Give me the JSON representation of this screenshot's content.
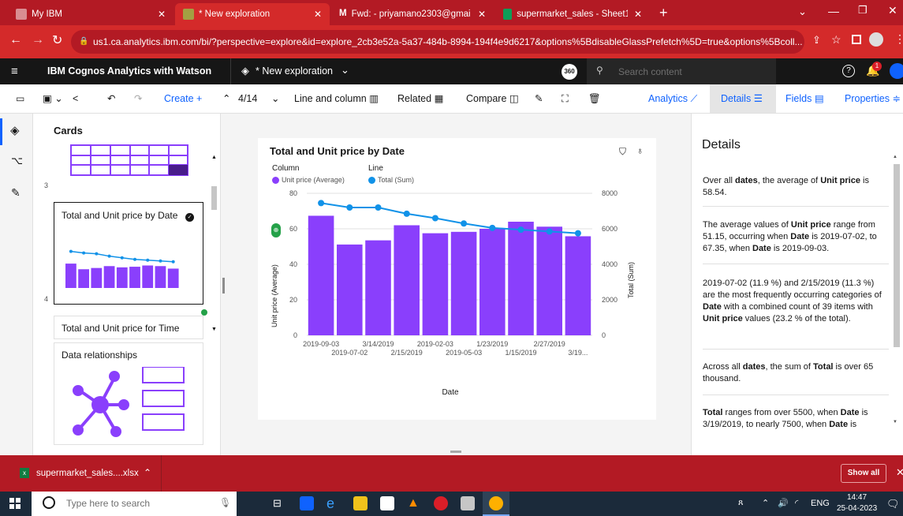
{
  "browser": {
    "tabs": [
      {
        "title": "My IBM",
        "active": false
      },
      {
        "title": "* New exploration",
        "active": true
      },
      {
        "title": "Fwd: - priyamano2303@gmail.co",
        "active": false
      },
      {
        "title": "supermarket_sales - Sheet1 - Goo",
        "active": false
      }
    ],
    "new_tab": "+",
    "url": "us1.ca.analytics.ibm.com/bi/?perspective=explore&id=explore_2cb3e52a-5a37-484b-8994-194f4e9d6217&options%5BdisableGlassPrefetch%5D=true&options%5Bcoll..."
  },
  "app": {
    "product": "IBM Cognos Analytics with Watson",
    "exploration": "* New exploration",
    "badge": "360",
    "search_placeholder": "Search content",
    "notifications": "1"
  },
  "toolbar": {
    "create": "Create +",
    "page": "4/14",
    "line_and_column": "Line and column",
    "related": "Related",
    "compare": "Compare",
    "analytics": "Analytics",
    "details": "Details",
    "fields": "Fields",
    "properties": "Properties"
  },
  "cards_panel": {
    "title": "Cards",
    "num_3": "3",
    "num_4": "4",
    "card_selected_title": "Total and Unit price by Date",
    "card_next_title": "Total and Unit price for Time",
    "card_rel_title": "Data relationships",
    "thumb_bars": [
      0.78,
      0.6,
      0.64,
      0.7,
      0.66,
      0.68,
      0.72,
      0.7,
      0.62
    ],
    "thumb_line": [
      0.92,
      0.88,
      0.86,
      0.8,
      0.76,
      0.72,
      0.7,
      0.68,
      0.66
    ]
  },
  "chart_data": {
    "type": "bar",
    "title": "Total and Unit price by Date",
    "legend_column_title": "Column",
    "legend_line_title": "Line",
    "legend_placement": "top-left",
    "categories": [
      "2019-09-03",
      "2019-07-02",
      "3/14/2019",
      "2/15/2019",
      "2019-02-03",
      "2019-05-03",
      "1/23/2019",
      "1/15/2019",
      "2/27/2019",
      "3/19..."
    ],
    "series": [
      {
        "name": "Unit price (Average)",
        "type": "bar",
        "axis": "left",
        "color": "#8a3ffc",
        "values": [
          67.35,
          51.15,
          53.5,
          62.0,
          57.5,
          58.3,
          60.0,
          64.0,
          61.2,
          55.8
        ]
      },
      {
        "name": "Total (Sum)",
        "type": "line",
        "axis": "right",
        "color": "#1192e8",
        "values": [
          7450,
          7200,
          7200,
          6850,
          6600,
          6300,
          6050,
          5950,
          5850,
          5750
        ]
      }
    ],
    "xlabel": "Date",
    "ylabel_left": "Unit price (Average)",
    "ylabel_right": "Total (Sum)",
    "ylim_left": [
      0,
      80
    ],
    "yticks_left": [
      "0",
      "20",
      "40",
      "60",
      "80"
    ],
    "ylim_right": [
      0,
      8000
    ],
    "yticks_right": [
      "0",
      "2000",
      "4000",
      "6000",
      "8000"
    ],
    "grid": true
  },
  "details": {
    "title": "Details",
    "insights": [
      {
        "parts": [
          [
            "Over all ",
            false
          ],
          [
            "dates",
            true
          ],
          [
            ", the average of ",
            false
          ],
          [
            "Unit price",
            true
          ],
          [
            " is 58.54.",
            false
          ]
        ]
      },
      {
        "parts": [
          [
            "The average values of ",
            false
          ],
          [
            "Unit price",
            true
          ],
          [
            " range from 51.15, occurring when ",
            false
          ],
          [
            "Date",
            true
          ],
          [
            " is 2019-07-02, to 67.35, when ",
            false
          ],
          [
            "Date",
            true
          ],
          [
            " is 2019-09-03.",
            false
          ]
        ]
      },
      {
        "parts": [
          [
            "2019-07-02 (11.9 %) and 2/15/2019 (11.3 %) are the most frequently occurring categories of ",
            false
          ],
          [
            "Date",
            true
          ],
          [
            " with a combined count of 39 items with ",
            false
          ],
          [
            "Unit price",
            true
          ],
          [
            " values (23.2 % of the total).",
            false
          ]
        ]
      },
      {
        "parts": [
          [
            "Across all ",
            false
          ],
          [
            "dates",
            true
          ],
          [
            ", the sum of ",
            false
          ],
          [
            "Total",
            true
          ],
          [
            " is over 65 thousand.",
            false
          ]
        ]
      },
      {
        "parts": [
          [
            "Total",
            true
          ],
          [
            " ranges from over 5500, when ",
            false
          ],
          [
            "Date",
            true
          ],
          [
            " is 3/19/2019, to nearly 7500, when ",
            false
          ],
          [
            "Date",
            true
          ],
          [
            " is",
            false
          ]
        ]
      }
    ]
  },
  "downloads": {
    "file": "supermarket_sales....xlsx",
    "show_all": "Show all"
  },
  "taskbar": {
    "search_placeholder": "Type here to search",
    "lang": "ENG",
    "time": "14:47",
    "date": "25-04-2023"
  }
}
